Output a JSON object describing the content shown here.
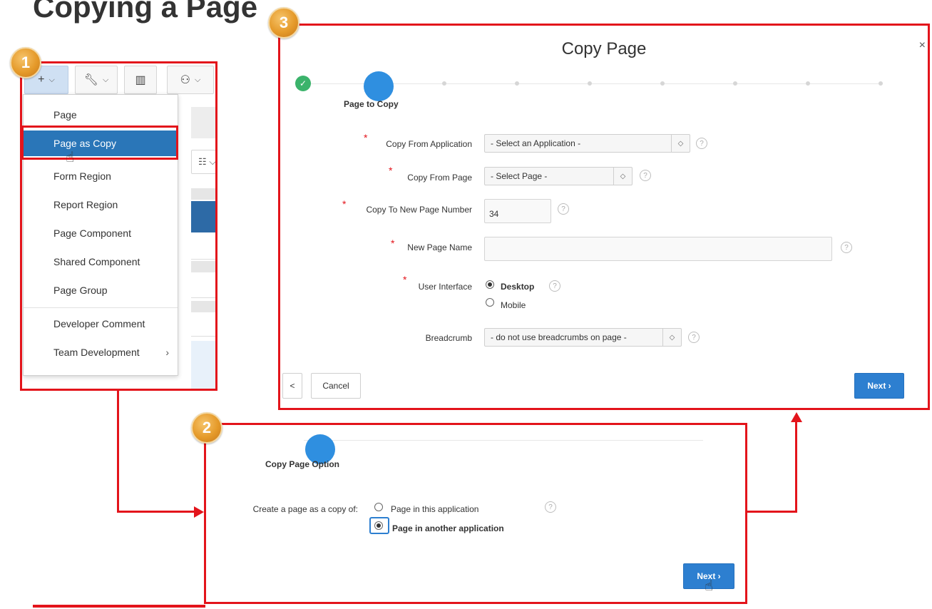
{
  "slide": {
    "title": "Copying a Page"
  },
  "badges": [
    "1",
    "2",
    "3"
  ],
  "create_menu": {
    "toolbar_icons": [
      "plus-icon",
      "wrench-icon",
      "layout-icon",
      "people-icon"
    ],
    "items": [
      {
        "label": "Page"
      },
      {
        "label": "Page as Copy",
        "selected": true
      },
      {
        "label": "Form Region"
      },
      {
        "label": "Report Region"
      },
      {
        "label": "Page Component"
      },
      {
        "label": "Shared Component"
      },
      {
        "label": "Page Group"
      },
      {
        "label": "Developer Comment"
      },
      {
        "label": "Team Development",
        "submenu": true
      }
    ]
  },
  "copy_page_dialog": {
    "title": "Copy Page",
    "close": "×",
    "section": "Page to Copy",
    "fields": {
      "copy_from_application": {
        "label": "Copy From Application",
        "value": "- Select an Application -"
      },
      "copy_from_page": {
        "label": "Copy From Page",
        "value": "- Select Page -"
      },
      "copy_to_new_page_number": {
        "label": "Copy To New Page Number",
        "value": "34"
      },
      "new_page_name": {
        "label": "New Page Name",
        "value": ""
      },
      "user_interface": {
        "label": "User Interface",
        "options": [
          "Desktop",
          "Mobile"
        ],
        "selected": "Desktop"
      },
      "breadcrumb": {
        "label": "Breadcrumb",
        "value": "- do not use breadcrumbs on page -"
      }
    },
    "buttons": {
      "back": "<",
      "cancel": "Cancel",
      "next": "Next"
    }
  },
  "copy_option_dialog": {
    "section": "Copy Page Option",
    "label": "Create a page as a copy of:",
    "options": [
      "Page in this application",
      "Page in another application"
    ],
    "selected": "Page in another application",
    "buttons": {
      "next": "Next"
    }
  },
  "colors": {
    "frame": "#e3141b",
    "accent": "#2d7fd0",
    "badge": "#e59a2a",
    "selected_menu": "#2a76b8"
  }
}
